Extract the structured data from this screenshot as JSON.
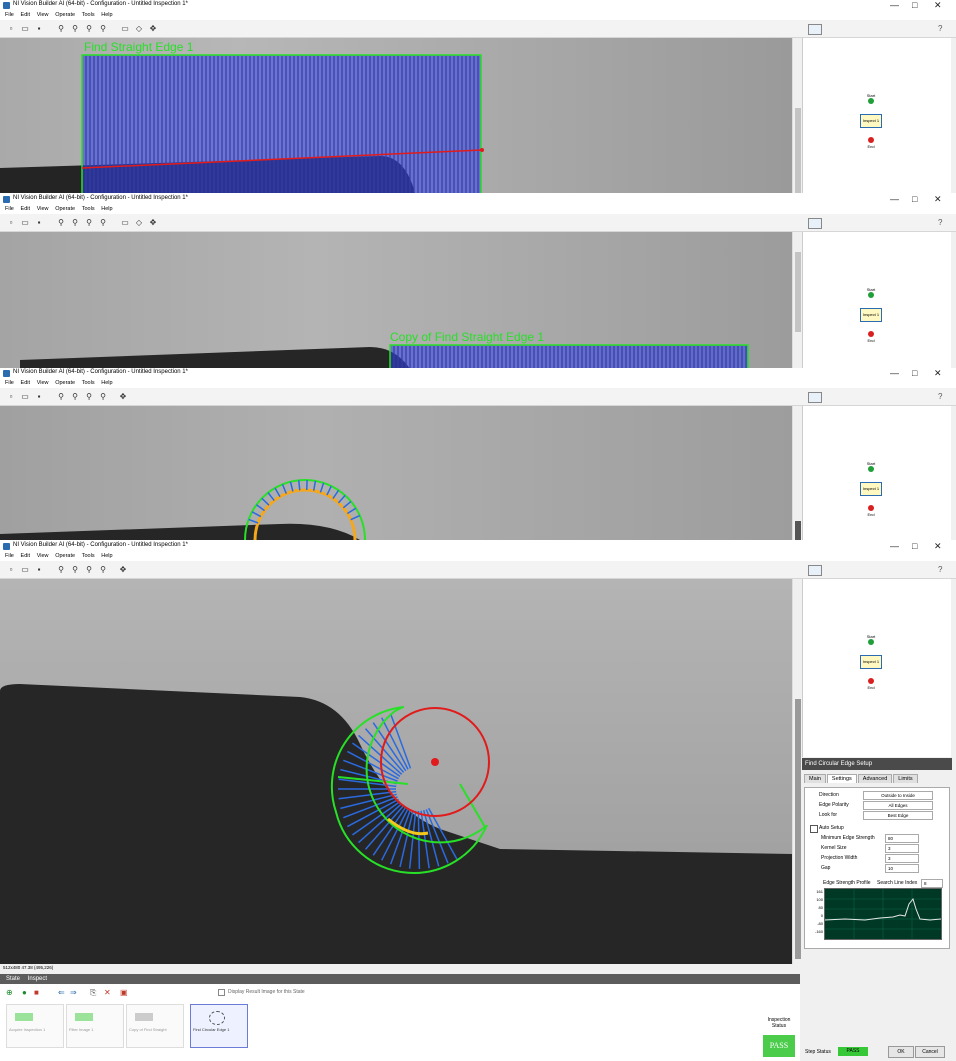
{
  "window": {
    "title": "NI Vision Builder AI (64-bit) - Configuration - Untitled Inspection 1*",
    "controls": [
      "—",
      "□",
      "✕"
    ]
  },
  "menu": [
    "File",
    "Edit",
    "View",
    "Operate",
    "Tools",
    "Help"
  ],
  "flowchart": {
    "start": "Start",
    "step": "Inspect 1",
    "end": "End"
  },
  "roi_labels": {
    "first": "Find Straight Edge 1",
    "copy": "Copy of Find Straight Edge 1"
  },
  "coord_readout": "512x480 47.38  (495,226)",
  "setup": {
    "header": "Find Circular Edge Setup",
    "tabs": [
      "Main",
      "Settings",
      "Advanced",
      "Limits"
    ],
    "direction_label": "Direction",
    "direction_value": "Outside to Inside",
    "edge_polarity_label": "Edge Polarity",
    "edge_polarity_value": "All Edges",
    "look_for_label": "Look for",
    "look_for_value": "Best Edge",
    "auto_setup_label": "Auto Setup",
    "min_edge_strength_label": "Minimum Edge Strength",
    "min_edge_strength_value": "80",
    "kernel_size_label": "Kernel Size",
    "kernel_size_value": "3",
    "projection_width_label": "Projection Width",
    "projection_width_value": "3",
    "gap_label": "Gap",
    "gap_value": "10",
    "graph_title": "Edge Strength Profile",
    "search_line_label": "Search Line Index",
    "search_line_value": "8",
    "graph_y_ticks": [
      "161",
      "100",
      "80",
      "0",
      "-80",
      "-160"
    ],
    "step_status_label": "Step Status",
    "step_status_value": "PASS",
    "ok_label": "OK",
    "cancel_label": "Cancel"
  },
  "state_bar": {
    "state": "State",
    "value": "Inspect"
  },
  "display_result_label": "Display Result Image for this State",
  "steps": [
    "Acquire Inspection 1",
    "Filter Image 1",
    "Copy of Find Straight",
    "Find Circular Edge 1"
  ],
  "inspection_status": {
    "label": "Inspection Status",
    "value": "PASS"
  },
  "colors": {
    "roi_green": "#27e027",
    "edge_red": "#e11b1b",
    "projection_blue": "#2450d8",
    "pass_green": "#4bcc4b"
  }
}
